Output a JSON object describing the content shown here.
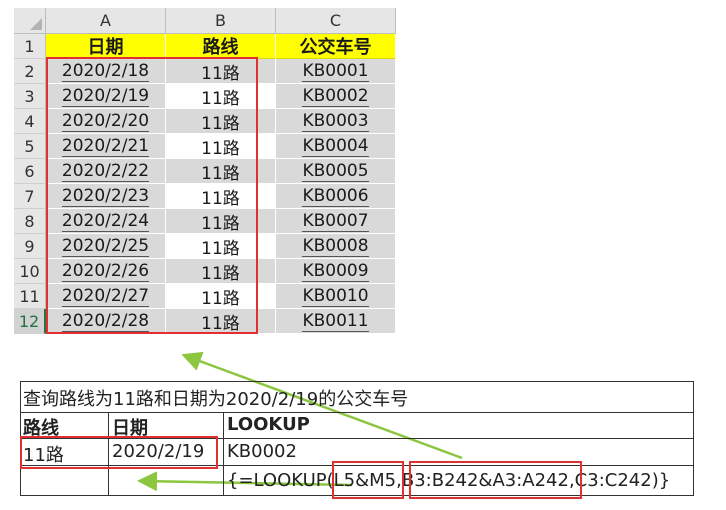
{
  "sheet": {
    "columns": [
      "A",
      "B",
      "C"
    ],
    "header_row_number": "1",
    "headers": [
      "日期",
      "路线",
      "公交车号"
    ],
    "rows": [
      {
        "num": "2",
        "date": "2020/2/18",
        "route": "11路",
        "bus": "KB0001"
      },
      {
        "num": "3",
        "date": "2020/2/19",
        "route": "11路",
        "bus": "KB0002"
      },
      {
        "num": "4",
        "date": "2020/2/20",
        "route": "11路",
        "bus": "KB0003"
      },
      {
        "num": "5",
        "date": "2020/2/21",
        "route": "11路",
        "bus": "KB0004"
      },
      {
        "num": "6",
        "date": "2020/2/22",
        "route": "11路",
        "bus": "KB0005"
      },
      {
        "num": "7",
        "date": "2020/2/23",
        "route": "11路",
        "bus": "KB0006"
      },
      {
        "num": "8",
        "date": "2020/2/24",
        "route": "11路",
        "bus": "KB0007"
      },
      {
        "num": "9",
        "date": "2020/2/25",
        "route": "11路",
        "bus": "KB0008"
      },
      {
        "num": "10",
        "date": "2020/2/26",
        "route": "11路",
        "bus": "KB0009"
      },
      {
        "num": "11",
        "date": "2020/2/27",
        "route": "11路",
        "bus": "KB0010"
      },
      {
        "num": "12",
        "date": "2020/2/28",
        "route": "11路",
        "bus": "KB0011"
      }
    ],
    "accent_color": "#ffff00",
    "highlight_color": "#e03030",
    "arrow_color": "#8cc63f"
  },
  "lookup_table": {
    "title": "查询路线为11路和日期为2020/2/19的公交车号",
    "headers": [
      "路线",
      "日期",
      "LOOKUP"
    ],
    "route_value": "11路",
    "date_value": "2020/2/19",
    "result_value": "KB0002",
    "formula": "{=LOOKUP(L5&M5,B3:B242&A3:A242,C3:C242)}"
  }
}
